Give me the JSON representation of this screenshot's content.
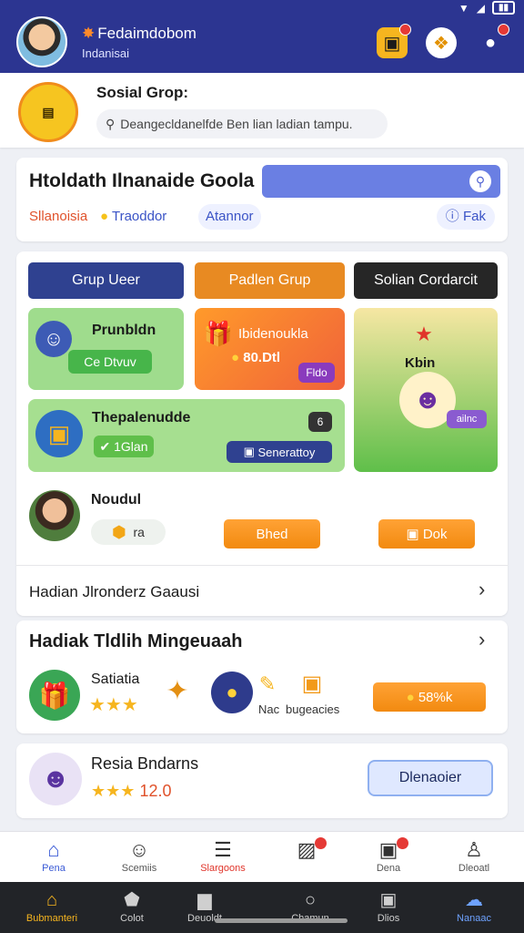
{
  "top": {
    "name": "Fedaimdobom",
    "subtitle": "Indanisai"
  },
  "group": {
    "title": "Sosial Grop:",
    "search_placeholder": "Deangecldanelfde Ben lian ladian tampu."
  },
  "hero": {
    "title": "Htoldath Ilnanaide Goola",
    "tag1": "Sllanoisia",
    "tag2": "Traoddor",
    "tag3": "Atannor",
    "button": "Fak"
  },
  "tabs": [
    "Grup Ueer",
    "Padlen Grup",
    "Solian Cordarcit"
  ],
  "tiles": {
    "t1_title": "Prunbldn",
    "t1_pill": "Ce Dtvuv",
    "t2_title": "Ibidenoukla",
    "t2_value": "80.Dtl",
    "t2_chip": "Fldo",
    "t3_title": "Thepalenudde",
    "t3_pill": "1Glan",
    "t3_button": "Senerattoy",
    "t3_badge": "6",
    "t4_title": "Kbin",
    "t4_chip": "ailnc"
  },
  "member": {
    "name": "Noudul",
    "chip": "ra",
    "btn1": "Bhed",
    "btn2": "Dok"
  },
  "row": {
    "label": "Hadian Jlronderz Gaausi"
  },
  "gift": {
    "title": "Hadiak Tldlih Mingeuaah",
    "item1_label": "Satiatia",
    "item3_label": "Nac",
    "item4_label": "bugeacies",
    "button": "58%k"
  },
  "bottom": {
    "name": "Resia Bndarns",
    "rating": "12.0",
    "button": "Dlenaoier"
  },
  "nav": [
    "Pena",
    "Scemiis",
    "Slargoons",
    "",
    "Dena",
    "Dleoatl"
  ],
  "sys": [
    "Bubmanteri",
    "Colot",
    "Deuoldt",
    "Chamun",
    "Dlios",
    "Nanaac"
  ]
}
